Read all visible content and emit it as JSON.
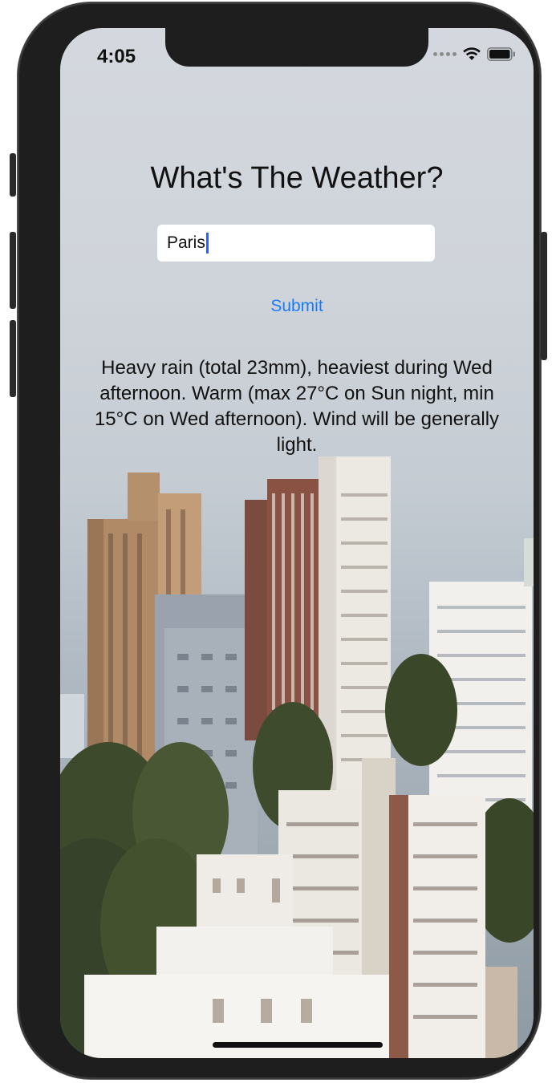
{
  "status_bar": {
    "time": "4:05",
    "icons": [
      "signal-dots-icon",
      "wifi-icon",
      "battery-icon"
    ]
  },
  "app": {
    "title": "What's The Weather?",
    "city_input": {
      "value": "Paris",
      "placeholder": ""
    },
    "submit_label": "Submit",
    "forecast_text": "Heavy rain (total 23mm), heaviest during Wed afternoon. Warm (max 27°C on Sun night, min 15°C on Wed afternoon). Wind will be generally light."
  },
  "background": {
    "subject": "city-skyline-photo"
  },
  "colors": {
    "link_blue": "#1a7cf5",
    "caret": "#2f5bff",
    "device_frame": "#1e1e1e"
  }
}
